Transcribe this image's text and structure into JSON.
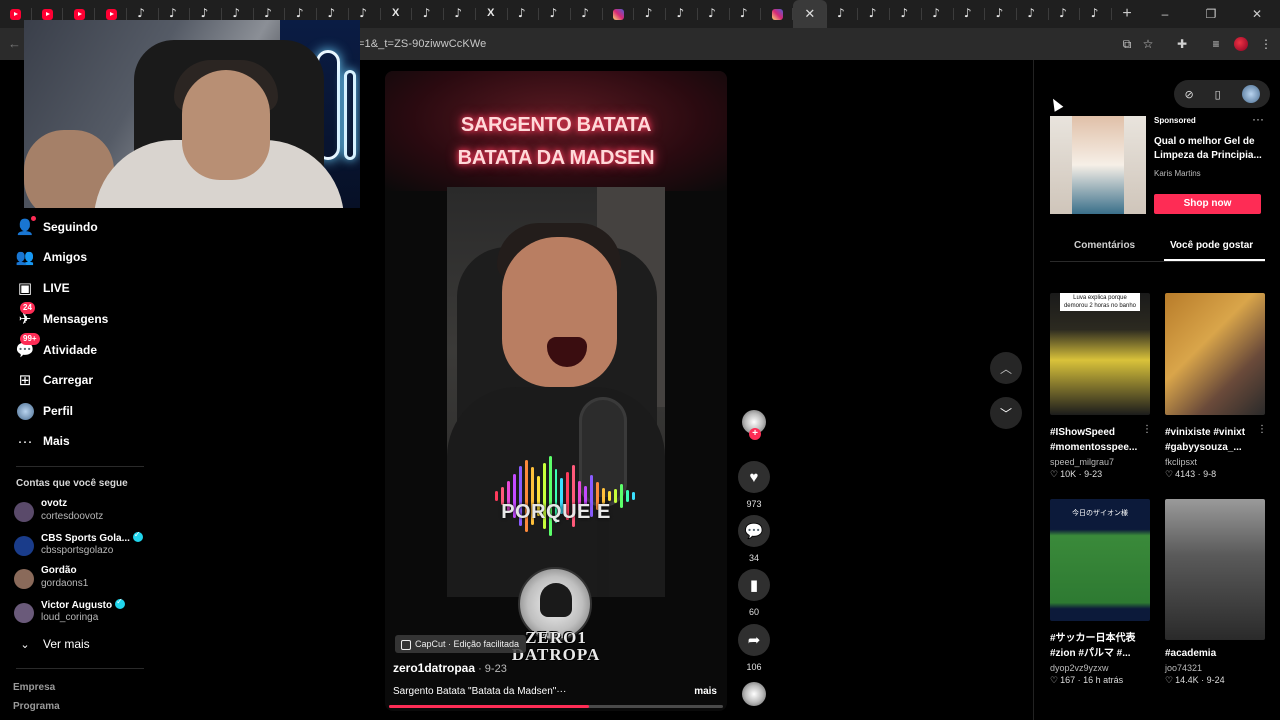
{
  "browser": {
    "tabs": [
      "youtube",
      "youtube",
      "youtube",
      "youtube",
      "tiktok",
      "tiktok",
      "tiktok",
      "tiktok",
      "tiktok",
      "tiktok",
      "tiktok",
      "tiktok",
      "x",
      "tiktok",
      "tiktok",
      "x",
      "tiktok",
      "tiktok",
      "tiktok",
      "instagram",
      "tiktok",
      "tiktok",
      "tiktok",
      "tiktok",
      "instagram",
      "active",
      "tiktok",
      "tiktok",
      "tiktok",
      "tiktok",
      "tiktok",
      "tiktok",
      "tiktok",
      "tiktok",
      "tiktok"
    ],
    "new_tab": "+",
    "url": "=1&_t=ZS-90ziwwCcKWe",
    "window_controls": [
      "–",
      "❐",
      "✕"
    ]
  },
  "nav": {
    "items": [
      {
        "icon": "following-icon",
        "label": "Seguindo"
      },
      {
        "icon": "friends-icon",
        "label": "Amigos"
      },
      {
        "icon": "live-icon",
        "label": "LIVE"
      },
      {
        "icon": "messages-icon",
        "label": "Mensagens",
        "badge": "24"
      },
      {
        "icon": "activity-icon",
        "label": "Atividade",
        "badge": "99+"
      },
      {
        "icon": "upload-icon",
        "label": "Carregar"
      },
      {
        "icon": "profile-icon",
        "label": "Perfil"
      },
      {
        "icon": "more-icon",
        "label": "Mais"
      }
    ],
    "following_header": "Contas que você segue",
    "following": [
      {
        "name": "ovotz",
        "handle": "cortesdoovotz",
        "verified": false,
        "color": "#5a4a6a"
      },
      {
        "name": "CBS Sports Gola...",
        "handle": "cbssportsgolazo",
        "verified": true,
        "color": "#1a3c8a"
      },
      {
        "name": "Gordão",
        "handle": "gordaons1",
        "verified": false,
        "color": "#8a6a5a"
      },
      {
        "name": "Victor Augusto",
        "handle": "loud_coringa",
        "verified": true,
        "color": "#6a5a7a"
      }
    ],
    "see_more": "Ver mais",
    "footer": [
      "Empresa",
      "Programa"
    ]
  },
  "video": {
    "title_line1": "SARGENTO BATATA",
    "title_line2": "BATATA DA MADSEN",
    "overlay_text": "PORQUE E",
    "logo_line1": "ZERO1",
    "logo_line2": "DATROPA",
    "capcut": "CapCut · Edição facilitada",
    "author": "zero1datropaa",
    "date": " · 9-23",
    "caption": "Sargento Batata \"Batata da Madsen\"···",
    "more": "mais",
    "progress": 0.6
  },
  "actions": {
    "likes": "973",
    "comments": "34",
    "saves": "60",
    "shares": "106"
  },
  "right": {
    "ad": {
      "sponsored": "Sponsored",
      "title": "Qual o melhor Gel de Limpeza da Principia...",
      "brand": "Karis Martins",
      "cta": "Shop now"
    },
    "tabs": [
      "Comentários",
      "Você pode gostar"
    ],
    "cards": [
      {
        "title": "#IShowSpeed #momentosspee...",
        "user": "speed_milgrau7",
        "likes": "10K",
        "date": "9-23",
        "overlay": "Luva explica porque demorou 2 horas no banho"
      },
      {
        "title": "#vinixiste #vinixt #gabyysouza_...",
        "user": "fkclipsxt",
        "likes": "4143",
        "date": "9-8"
      },
      {
        "title": "#サッカー日本代表 #zion #パルマ #...",
        "user": "dyop2vz9yzxw",
        "likes": "167",
        "date": "16 h atrás",
        "overlay": "今日のザイオン様"
      },
      {
        "title": "#academia",
        "user": "joo74321",
        "likes": "14.4K",
        "date": "9-24"
      }
    ]
  }
}
